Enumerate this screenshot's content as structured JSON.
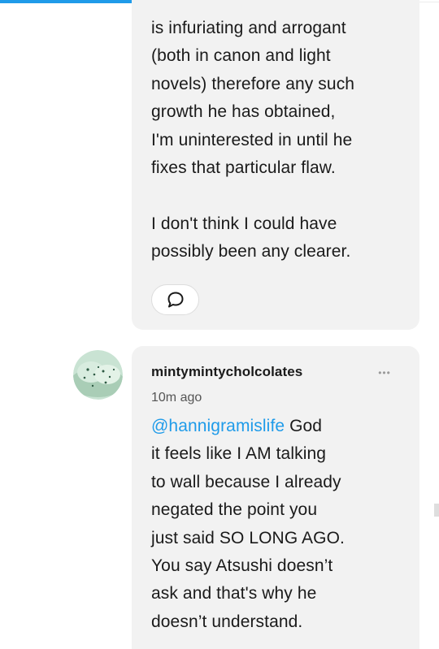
{
  "previous_comment": {
    "text": "is infuriating and arrogant\n(both in canon and light\nnovels) therefore any such\ngrowth he has obtained,\nI'm uninterested in until he\nfixes that particular flaw.\n\nI don't think I could have\npossibly been any clearer."
  },
  "comment": {
    "username": "mintymintycholcolates",
    "timestamp": "10m ago",
    "mention": "@hannigramislife",
    "text": " God\nit feels like I AM talking\nto wall because I already\nnegated the point you\njust said SO LONG AGO.\nYou say Atsushi doesn’t\nask and that's why he\ndoesn’t understand.",
    "more_glyph": "•••"
  },
  "icons": {
    "reply": "speech-bubble-icon",
    "more": "ellipsis-icon"
  },
  "colors": {
    "accent": "#1f9be9",
    "bubble": "#f2f2f2",
    "text": "#1a1a1a"
  }
}
